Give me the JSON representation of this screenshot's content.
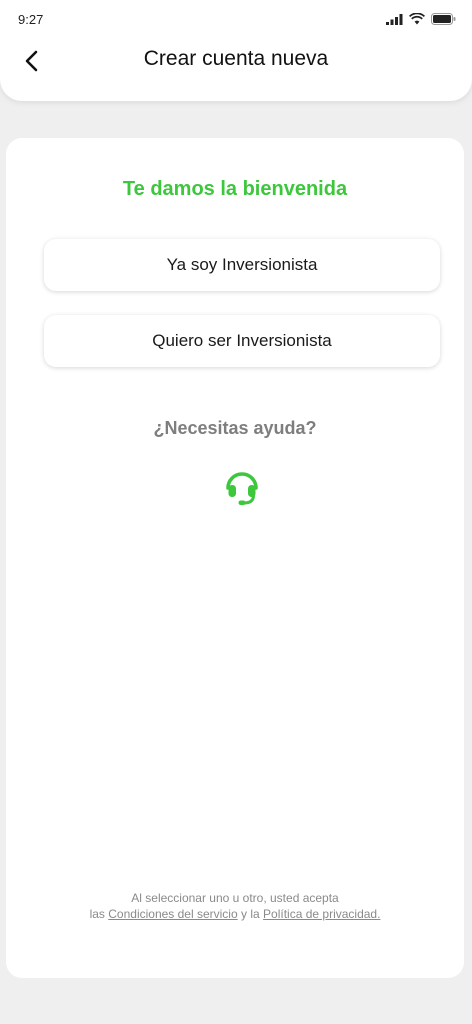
{
  "status_bar": {
    "time": "9:27",
    "icons": [
      "signal-icon",
      "wifi-icon",
      "battery-icon"
    ]
  },
  "header": {
    "back_icon": "chevron-left-icon",
    "title": "Crear cuenta nueva"
  },
  "main": {
    "welcome": "Te damos la bienvenida",
    "options": [
      {
        "label": "Ya soy Inversionista"
      },
      {
        "label": "Quiero ser Inversionista"
      }
    ],
    "help_text": "¿Necesitas ayuda?",
    "help_icon": "headset-icon"
  },
  "footer": {
    "line1": "Al seleccionar uno u otro, usted acepta",
    "prefix": "las",
    "terms_link": "Condiciones del servicio",
    "conjunction": "y la",
    "privacy_link": "Política de privacidad."
  },
  "colors": {
    "accent": "#3cc73c",
    "background": "#efefef",
    "muted_text": "#7e7e7e"
  }
}
